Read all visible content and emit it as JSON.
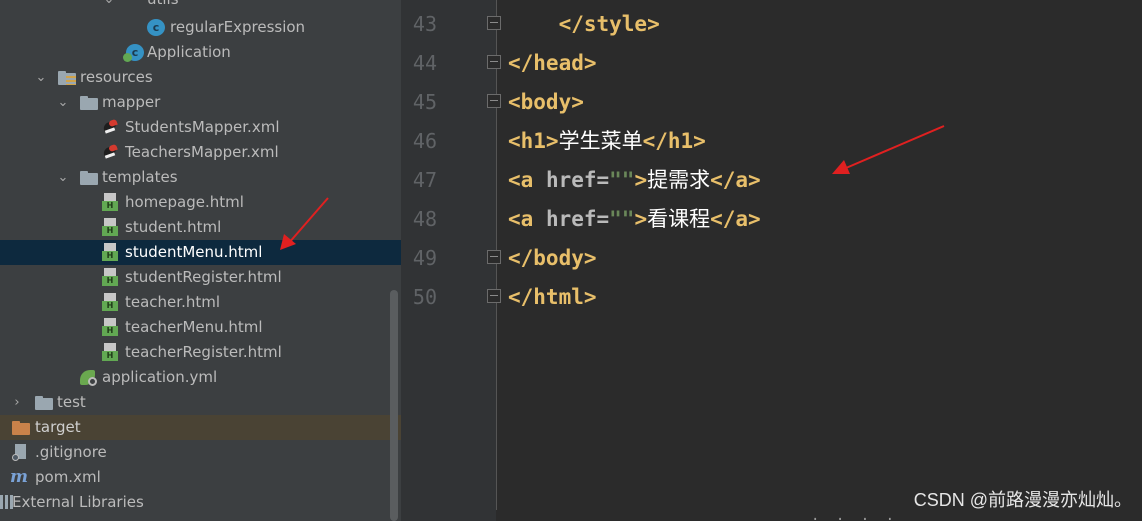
{
  "tree": {
    "partial_folder": "utils",
    "items": [
      {
        "label": "regularExpression",
        "icon": "class-icon"
      },
      {
        "label": "Application",
        "icon": "spring-boot-class-icon"
      },
      {
        "label": "resources",
        "icon": "resources-folder-icon"
      },
      {
        "label": "mapper",
        "icon": "folder-icon"
      },
      {
        "label": "StudentsMapper.xml",
        "icon": "mybatis-xml-icon"
      },
      {
        "label": "TeachersMapper.xml",
        "icon": "mybatis-xml-icon"
      },
      {
        "label": "templates",
        "icon": "folder-icon"
      },
      {
        "label": "homepage.html",
        "icon": "html-file-icon"
      },
      {
        "label": "student.html",
        "icon": "html-file-icon"
      },
      {
        "label": "studentMenu.html",
        "icon": "html-file-icon",
        "selected": true
      },
      {
        "label": "studentRegister.html",
        "icon": "html-file-icon"
      },
      {
        "label": "teacher.html",
        "icon": "html-file-icon"
      },
      {
        "label": "teacherMenu.html",
        "icon": "html-file-icon"
      },
      {
        "label": "teacherRegister.html",
        "icon": "html-file-icon"
      },
      {
        "label": "application.yml",
        "icon": "yml-file-icon"
      },
      {
        "label": "test",
        "icon": "folder-icon"
      },
      {
        "label": "target",
        "icon": "excluded-folder-icon"
      },
      {
        "label": ".gitignore",
        "icon": "gitignore-file-icon"
      },
      {
        "label": "pom.xml",
        "icon": "maven-icon"
      },
      {
        "label": "External Libraries",
        "icon": "libraries-icon"
      }
    ]
  },
  "editor": {
    "lines": [
      {
        "number": "43",
        "code": {
          "indent": "    ",
          "t1": "</style>"
        }
      },
      {
        "number": "44",
        "code": {
          "t1": "</head>"
        }
      },
      {
        "number": "45",
        "code": {
          "t1": "<body>"
        }
      },
      {
        "number": "46",
        "code": {
          "t1": "<h1>",
          "text": "学生菜单",
          "t2": "</h1>"
        }
      },
      {
        "number": "47",
        "code": {
          "t1": "<a ",
          "attr": "href=",
          "str": "\"\"",
          "t2": ">",
          "text": "提需求",
          "t3": "</a>"
        }
      },
      {
        "number": "48",
        "code": {
          "t1": "<a ",
          "attr": "href=",
          "str": "\"\"",
          "t2": ">",
          "text": "看课程",
          "t3": "</a>"
        }
      },
      {
        "number": "49",
        "code": {
          "t1": "</body>"
        }
      },
      {
        "number": "50",
        "code": {
          "t1": "</html>"
        }
      }
    ]
  },
  "watermark": "CSDN @前路漫漫亦灿灿。",
  "colors": {
    "tree_bg": "#3c3f41",
    "editor_bg": "#2b2b2b",
    "selection": "#0d293e",
    "tag": "#e8bf6a",
    "string": "#6a8759",
    "annotation_arrow": "#e02020"
  }
}
